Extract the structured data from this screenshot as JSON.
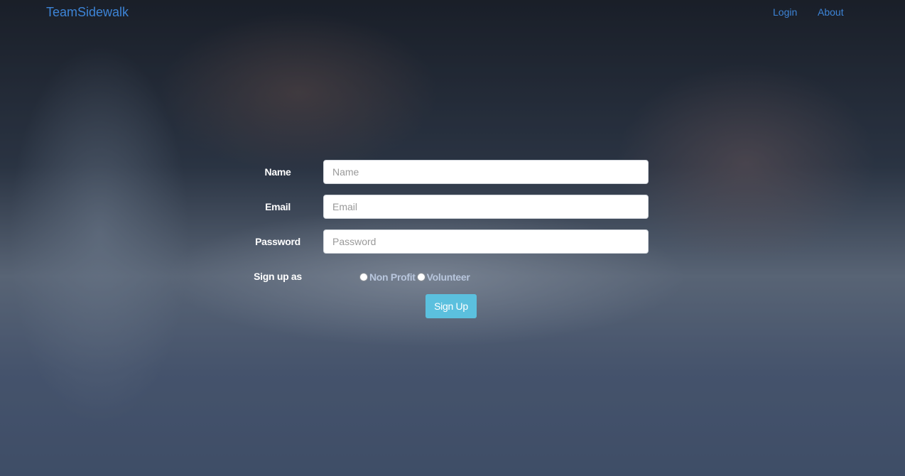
{
  "navbar": {
    "brand": "TeamSidewalk",
    "links": [
      "Login",
      "About"
    ]
  },
  "form": {
    "name": {
      "label": "Name",
      "placeholder": "Name",
      "value": ""
    },
    "email": {
      "label": "Email",
      "placeholder": "Email",
      "value": ""
    },
    "password": {
      "label": "Password",
      "placeholder": "Password",
      "value": ""
    },
    "signup_as": {
      "label": "Sign up as",
      "options": [
        "Non Profit",
        "Volunteer"
      ],
      "selected": null
    },
    "submit_label": "Sign Up"
  },
  "colors": {
    "brand": "#3d84d6",
    "button": "#5bc0de",
    "radio_label": "#b8c6dd"
  },
  "background": {
    "icon": "keyboard-typing-hands-photo"
  }
}
